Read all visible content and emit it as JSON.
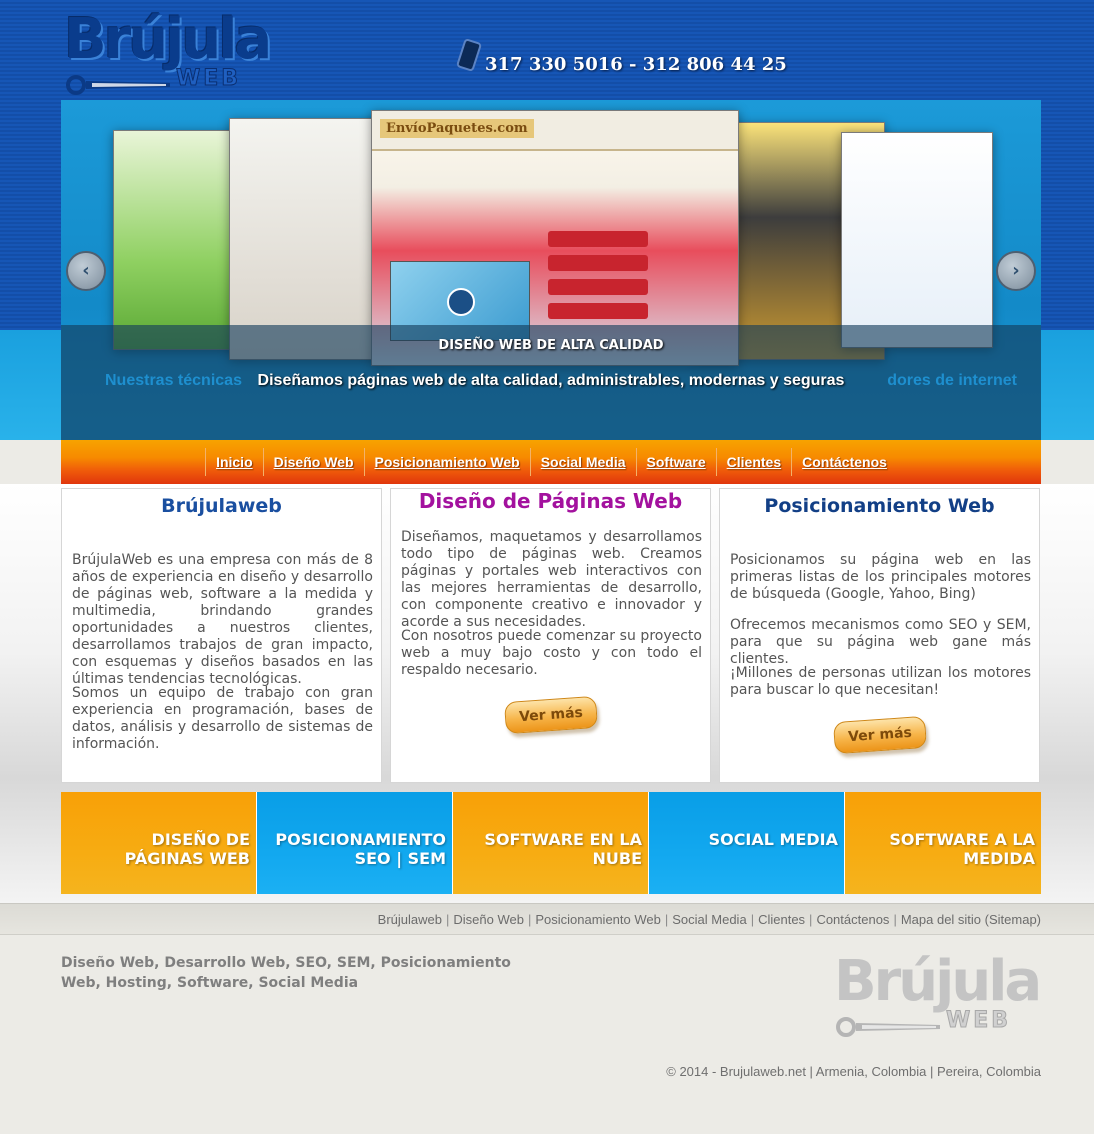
{
  "header": {
    "logo_text": "Brújula",
    "logo_sub": "WEB",
    "phone": "317 330 5016 - 312 806 44 25"
  },
  "slider": {
    "screen_logo": "EnvíoPaquetes.com",
    "caption": "DISEÑO WEB DE ALTA CALIDAD",
    "text": "Diseñamos páginas web de alta calidad, administrables, modernas y seguras",
    "ghost_left": "Nuestras técnicas",
    "ghost_right": "dores de internet",
    "prev_icon": "‹",
    "next_icon": "›"
  },
  "nav": {
    "items": [
      "Inicio",
      "Diseño Web",
      "Posicionamiento Web",
      "Social Media",
      "Software",
      "Clientes",
      "Contáctenos"
    ]
  },
  "columns": [
    {
      "title": "Brújulaweb",
      "paragraphs": [
        "BrújulaWeb es una empresa con más de 8 años de experiencia en diseño y desarrollo de páginas web, software a la medida y multimedia, brindando grandes oportunidades a nuestros clientes, desarrollamos trabajos de gran impacto, con esquemas y diseños basados en las últimas tendencias tecnológicas.",
        "Somos un equipo de trabajo con gran experiencia en programación, bases de datos, análisis y desarrollo de sistemas de información."
      ]
    },
    {
      "title": "Diseño de Páginas Web",
      "paragraphs": [
        "Diseñamos, maquetamos y desarrollamos todo tipo de páginas web. Creamos páginas y portales web interactivos con las mejores herramientas de desarrollo, con componente creativo e innovador y acorde a sus necesidades.",
        "Con nosotros puede comenzar su proyecto web a muy bajo costo y con todo el respaldo necesario."
      ],
      "button": "Ver más"
    },
    {
      "title": "Posicionamiento Web",
      "paragraphs": [
        "Posicionamos su página web en las primeras listas de los principales motores de búsqueda (Google, Yahoo, Bing)",
        "Ofrecemos mecanismos como SEO y SEM, para que su página web gane más clientes.",
        "¡Millones de personas utilizan los motores para buscar lo que necesitan!"
      ],
      "button": "Ver más"
    }
  ],
  "tiles": [
    {
      "label": "DISEÑO DE PÁGINAS WEB",
      "color": "#f8a007"
    },
    {
      "label": "POSICIONAMIENTO SEO | SEM",
      "color": "#099ee7"
    },
    {
      "label": "SOFTWARE EN LA NUBE",
      "color": "#f8a007"
    },
    {
      "label": "SOCIAL MEDIA",
      "color": "#099ee7"
    },
    {
      "label": "SOFTWARE A LA MEDIDA",
      "color": "#f8a007"
    }
  ],
  "footer": {
    "links": [
      "Brújulaweb",
      "Diseño Web",
      "Posicionamiento Web",
      "Social Media",
      "Clientes",
      "Contáctenos",
      "Mapa del sitio (Sitemap)"
    ],
    "separator": "|",
    "tagline": "Diseño Web, Desarrollo Web, SEO, SEM, Posicionamiento Web, Hosting, Software, Social Media",
    "logo_text": "Brújula",
    "logo_sub": "WEB",
    "copyright": "© 2014 - Brujulaweb.net | Armenia, Colombia | Pereira, Colombia"
  }
}
